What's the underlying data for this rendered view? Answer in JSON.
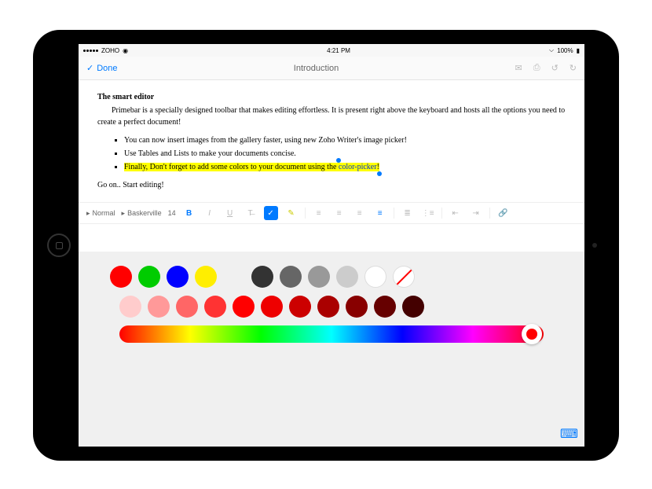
{
  "status": {
    "carrier": "ZOHO",
    "time": "4:21 PM",
    "battery": "100%"
  },
  "nav": {
    "done": "Done",
    "title": "Introduction"
  },
  "doc": {
    "heading": "The smart editor",
    "para": "Primebar is a specially designed toolbar that makes editing effortless. It is present right above the keyboard and hosts all the options you need to create a perfect document!",
    "bullets": [
      "You can now insert images from the gallery faster, using new Zoho Writer's image picker!",
      "Use Tables and Lists to make your documents concise."
    ],
    "hl_pre": "Finally, Don't forget to add some colors to your document using the ",
    "hl_link": "color-picker",
    "hl_post": "!",
    "outro": "Go on.. Start editing!"
  },
  "toolbar": {
    "style": "Normal",
    "font": "Baskerville",
    "size": "14"
  },
  "palette": {
    "row1": [
      "#ff0000",
      "#00cc00",
      "#0000ff",
      "#ffee00",
      "",
      "#333333",
      "#666666",
      "#999999",
      "#cccccc",
      "#ffffff",
      "nocolor"
    ],
    "row2": [
      "#ffcccc",
      "#ff9999",
      "#ff6666",
      "#ff3333",
      "#ff0000",
      "#ee0000",
      "#cc0000",
      "#aa0000",
      "#880000",
      "#660000",
      "#440000"
    ]
  }
}
